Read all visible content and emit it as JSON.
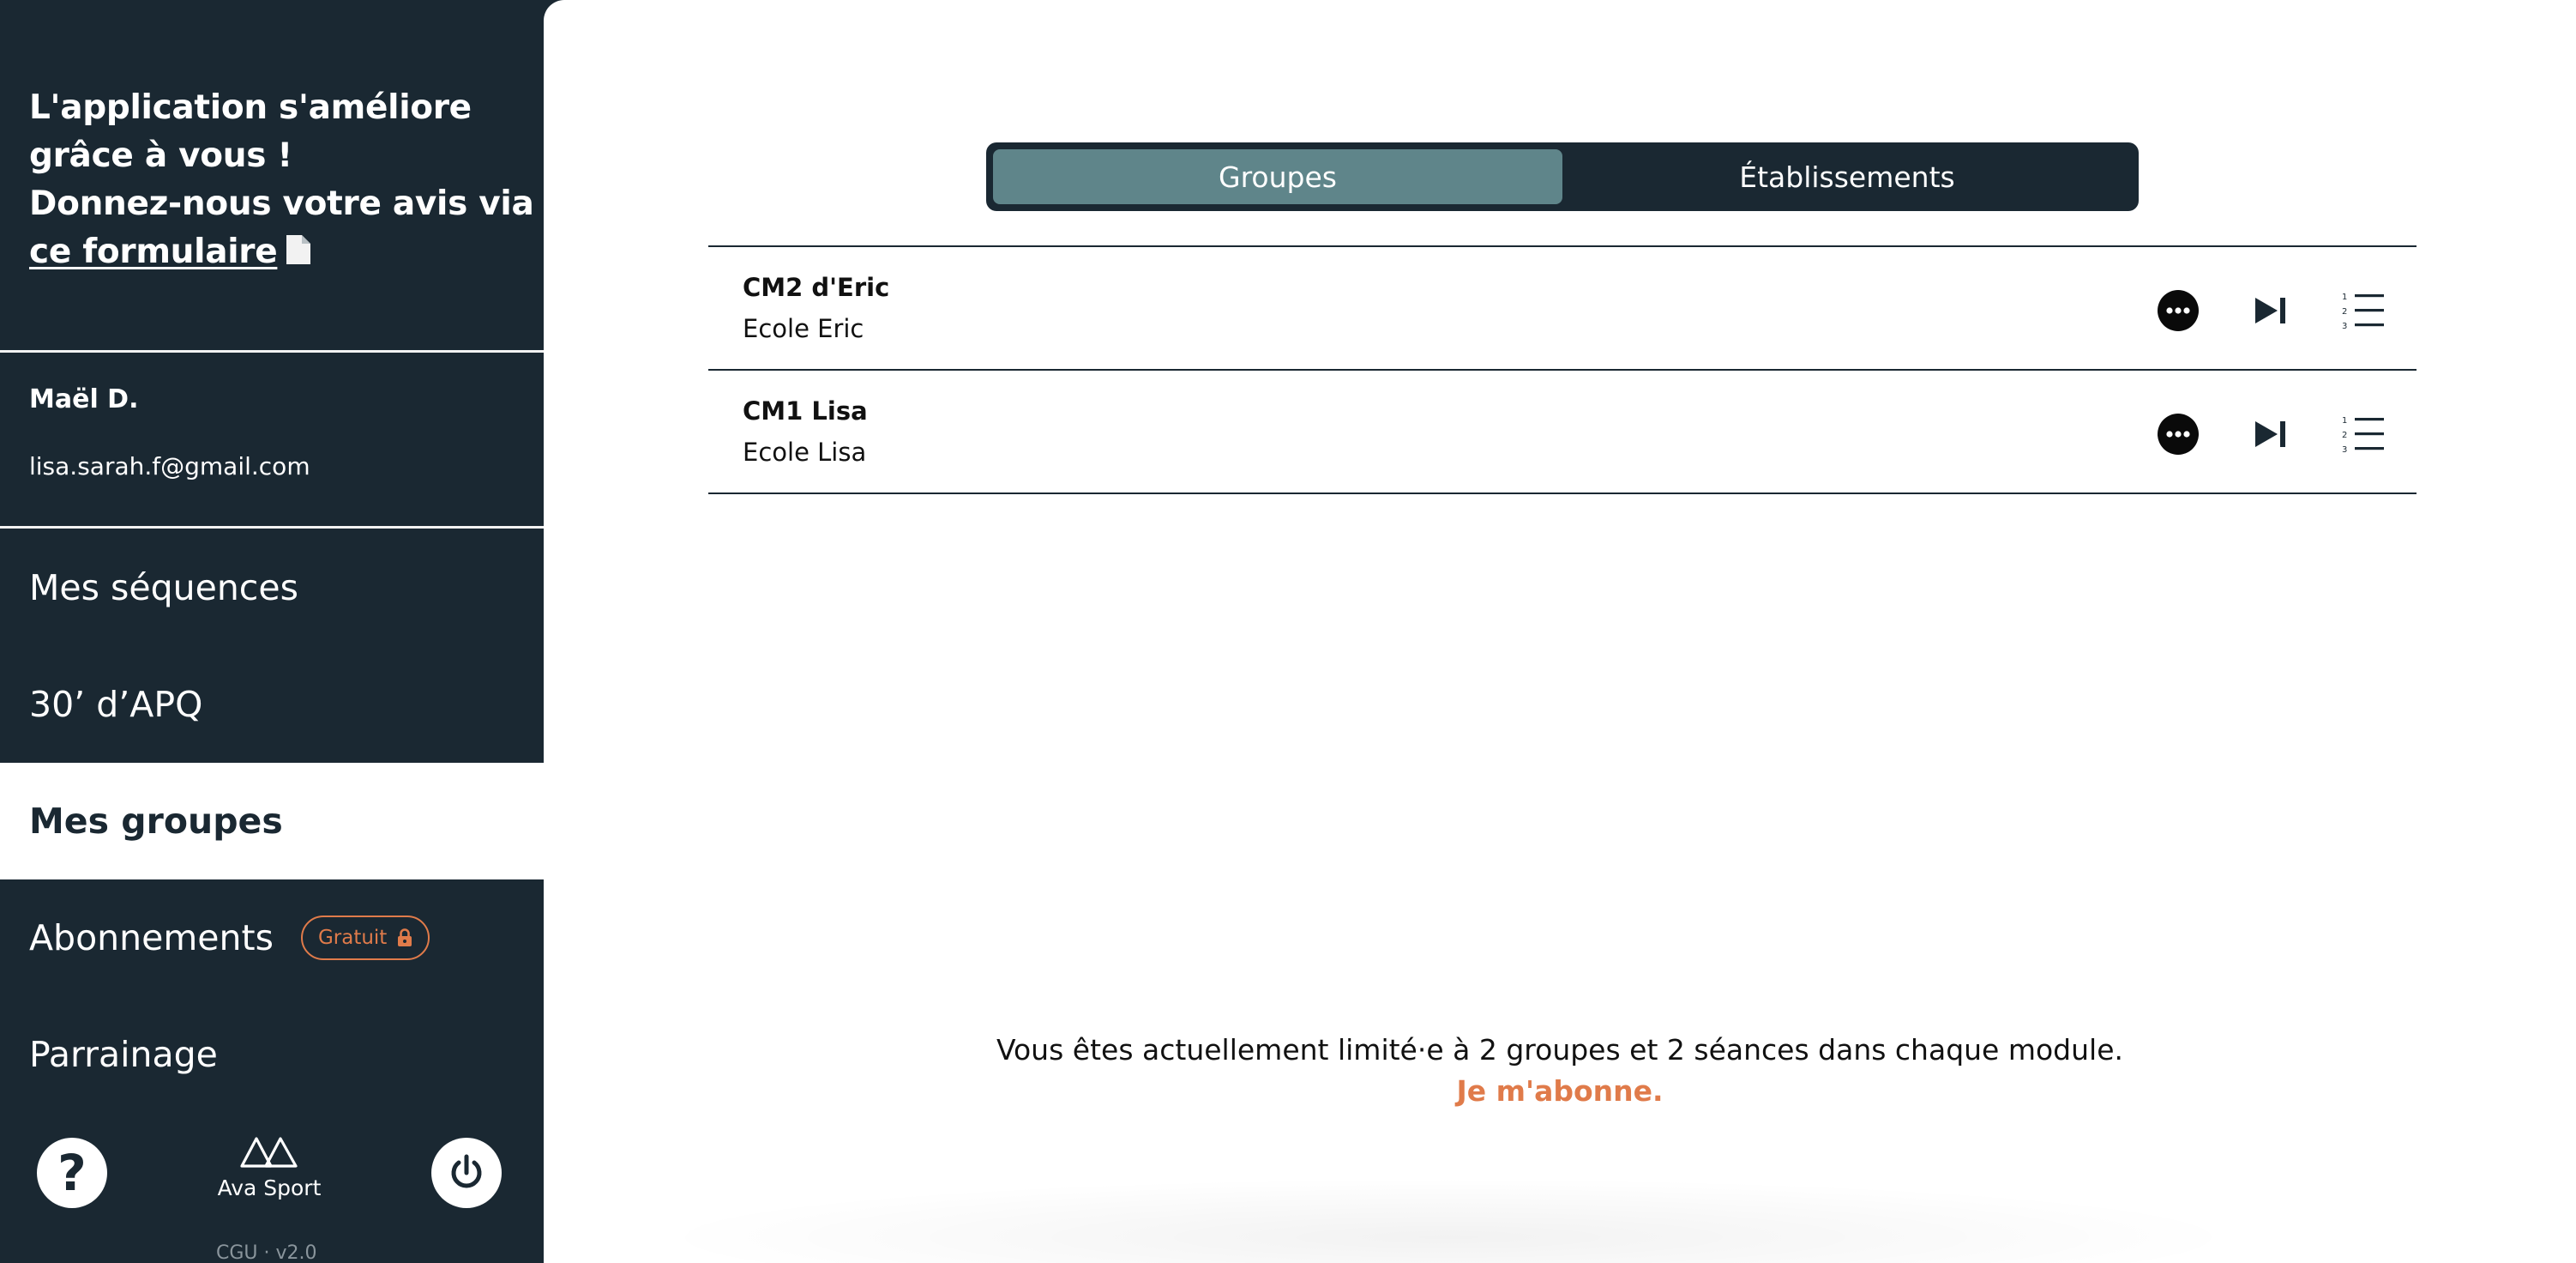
{
  "sidebar": {
    "feedback": {
      "line1": "L'application s'améliore",
      "line2": "grâce à vous !",
      "line3": "Donnez-nous votre avis via",
      "link_text": "ce formulaire",
      "icon": "document-icon"
    },
    "user": {
      "name": "Maël D.",
      "email": "lisa.sarah.f@gmail.com"
    },
    "nav": {
      "sequences": "Mes séquences",
      "apq": "30’ d’APQ",
      "groups": "Mes groupes",
      "subscriptions": "Abonnements",
      "subscription_badge": "Gratuit",
      "referral": "Parrainage"
    },
    "footer": {
      "help_icon": "question-mark-icon",
      "help_glyph": "?",
      "brand_name": "Ava Sport",
      "legal": "CGU · v2.0",
      "power_icon": "power-icon"
    }
  },
  "main": {
    "tabs": [
      {
        "label": "Groupes",
        "active": true
      },
      {
        "label": "Établissements",
        "active": false
      }
    ],
    "groups": [
      {
        "name": "CM2 d'Eric",
        "school": "Ecole Eric"
      },
      {
        "name": "CM1 Lisa",
        "school": "Ecole Lisa"
      }
    ],
    "row_action_icons": [
      "more-options-icon",
      "skip-next-icon",
      "numbered-list-icon"
    ],
    "notice": "Vous êtes actuellement limité·e à 2 groupes et 2 séances dans chaque module.",
    "subscribe_link": "Je m'abonne."
  },
  "colors": {
    "sidebar_bg": "#1a2832",
    "active_tab": "#5f858a",
    "accent": "#e07b4a"
  }
}
